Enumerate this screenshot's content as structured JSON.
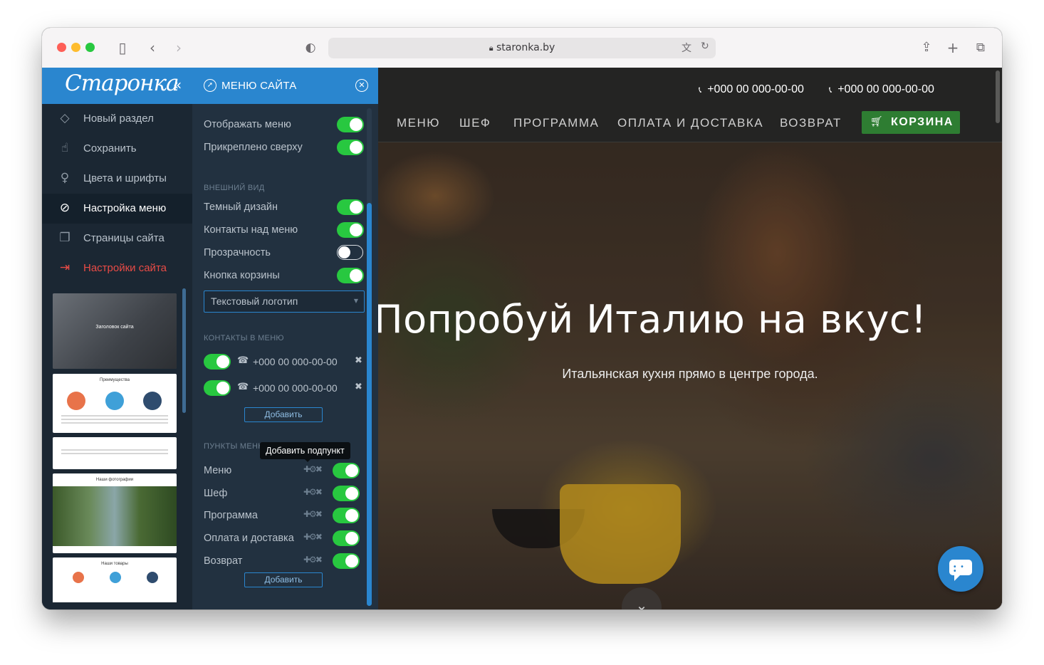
{
  "browser": {
    "url": "staronka.by",
    "icons": [
      "sidebar-toggle-icon",
      "back-icon",
      "forward-icon",
      "shield-icon",
      "lock-icon",
      "translate-icon",
      "reload-icon",
      "share-icon",
      "new-tab-icon",
      "tabs-icon"
    ]
  },
  "sidebar": {
    "logo": "Старонка",
    "collapse": "«",
    "items": [
      {
        "label": "Новый раздел",
        "icon": "new-section-icon",
        "glyph": "◇"
      },
      {
        "label": "Сохранить",
        "icon": "thumbs-up-icon",
        "glyph": "☝"
      },
      {
        "label": "Цвета и шрифты",
        "icon": "lightbulb-icon",
        "glyph": "♀"
      },
      {
        "label": "Настройка меню",
        "icon": "compass-icon",
        "glyph": "⊘"
      },
      {
        "label": "Страницы сайта",
        "icon": "pages-icon",
        "glyph": "❐"
      },
      {
        "label": "Настройки сайта",
        "icon": "exit-icon",
        "glyph": "⇥"
      }
    ],
    "thumbnails": [
      "Заголовок сайта",
      "Преимущества",
      "",
      "Наши фотографии",
      "Наши товары"
    ]
  },
  "panel": {
    "title": "МЕНЮ САЙТА",
    "toggles_top": [
      {
        "label": "Отображать меню",
        "on": true
      },
      {
        "label": "Прикреплено сверху",
        "on": true
      }
    ],
    "appearance_head": "ВНЕШНИЙ ВИД",
    "appearance": [
      {
        "label": "Темный дизайн",
        "on": true
      },
      {
        "label": "Контакты над меню",
        "on": true
      },
      {
        "label": "Прозрачность",
        "on": false
      },
      {
        "label": "Кнопка корзины",
        "on": true
      }
    ],
    "logo_select": "Текстовый логотип",
    "contacts_head": "КОНТАКТЫ В МЕНЮ",
    "contacts": [
      "+000 00 000-00-00",
      "+000 00 000-00-00"
    ],
    "add_label": "Добавить",
    "items_head": "ПУНКТЫ МЕНЮ",
    "tooltip": "Добавить подпункт",
    "menu_items": [
      "Меню",
      "Шеф",
      "Программа",
      "Оплата и доставка",
      "Возврат"
    ],
    "item_tools": "✚⚙✖"
  },
  "site": {
    "phones": [
      "+000 00 000-00-00",
      "+000 00 000-00-00"
    ],
    "nav": [
      "МЕНЮ",
      "ШЕФ",
      "ПРОГРАММА",
      "ОПЛАТА И ДОСТАВКА",
      "ВОЗВРАТ"
    ],
    "cart_label": "КОРЗИНА",
    "hero_title": "Попробуй Италию на вкус!",
    "hero_subtitle": "Итальянская кухня прямо в центре города."
  },
  "colors": {
    "accent": "#2a86cf",
    "toggle_on": "#28c840",
    "cart": "#2e7d32",
    "danger": "#e94b46",
    "sidebar_bg": "#1b2733",
    "panel_bg": "#223140"
  }
}
